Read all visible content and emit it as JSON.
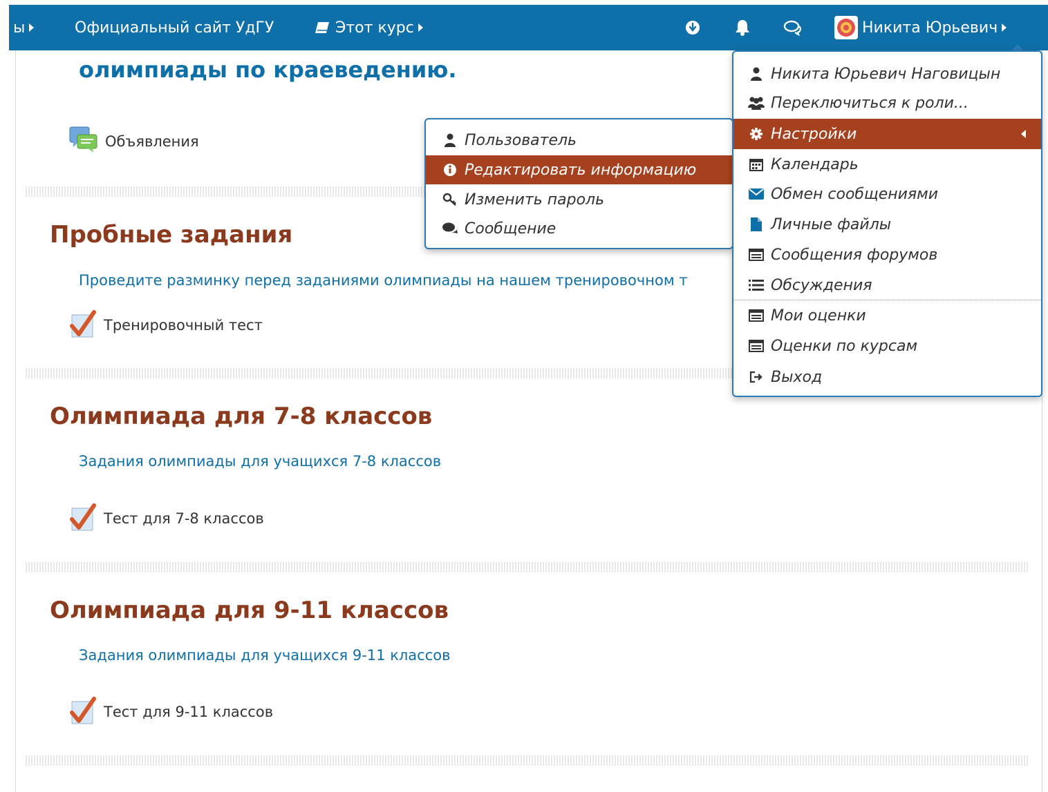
{
  "navbar": {
    "cut_item_label": "ы",
    "site_link": "Официальный сайт УдГУ",
    "course_menu": "Этот курс",
    "user_name": "Никита Юрьевич"
  },
  "content": {
    "intro_title": "олимпиады по краеведению.",
    "announcements_label": "Объявления",
    "sections": [
      {
        "title": "Пробные задания",
        "summary": "Проведите разминку перед заданиями олимпиады на нашем тренировочном т",
        "activity": "Тренировочный тест"
      },
      {
        "title": "Олимпиада для 7-8 классов",
        "summary": "Задания олимпиады для учащихся 7-8 классов",
        "activity": "Тест для 7-8 классов"
      },
      {
        "title": "Олимпиада для 9-11 классов",
        "summary": "Задания олимпиады для учащихся 9-11 классов",
        "activity": "Тест для 9-11 классов"
      }
    ]
  },
  "user_menu": {
    "items": [
      {
        "label": "Никита Юрьевич Наговицын",
        "icon": "user-icon"
      },
      {
        "label": "Переключиться к роли...",
        "icon": "users-icon"
      },
      {
        "label": "Настройки",
        "icon": "cog-icon"
      },
      {
        "label": "Календарь",
        "icon": "calendar-icon"
      },
      {
        "label": "Обмен сообщениями",
        "icon": "envelope-icon"
      },
      {
        "label": "Личные файлы",
        "icon": "file-icon"
      },
      {
        "label": "Сообщения форумов",
        "icon": "list-alt-icon"
      },
      {
        "label": "Обсуждения",
        "icon": "list-icon"
      },
      {
        "label": "Мои оценки",
        "icon": "list-alt-icon"
      },
      {
        "label": "Оценки по курсам",
        "icon": "list-alt-icon"
      },
      {
        "label": "Выход",
        "icon": "sign-out-icon"
      }
    ]
  },
  "settings_submenu": {
    "items": [
      {
        "label": "Пользователь",
        "icon": "user-icon"
      },
      {
        "label": "Редактировать информацию",
        "icon": "info-icon"
      },
      {
        "label": "Изменить пароль",
        "icon": "key-icon"
      },
      {
        "label": "Сообщение",
        "icon": "comments-icon"
      }
    ]
  },
  "colors": {
    "navbar": "#0f6fa8",
    "highlight": "#a6411f",
    "section_title": "#8b3a1e",
    "link": "#0f6fa8"
  }
}
